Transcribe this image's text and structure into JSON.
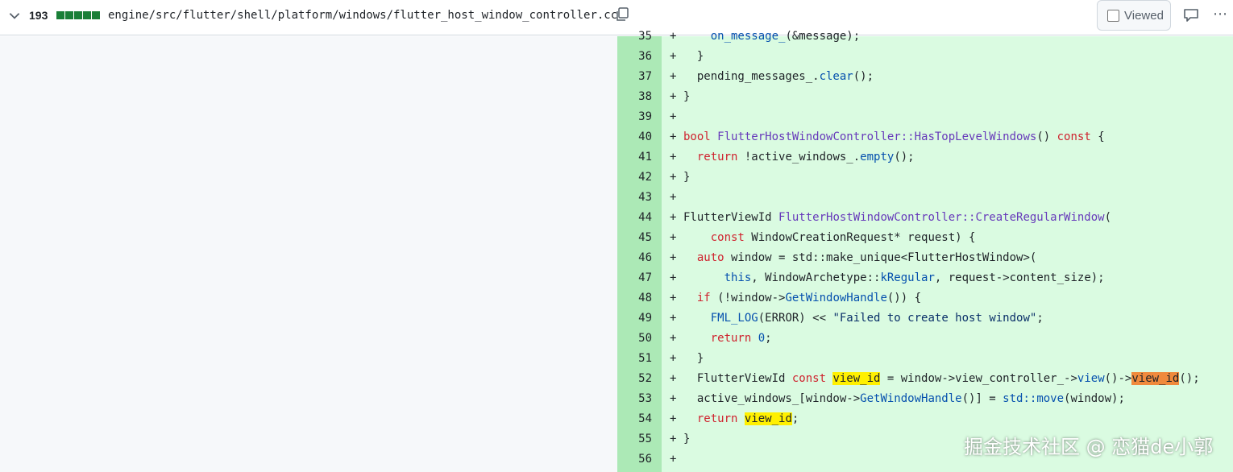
{
  "header": {
    "additions_count": "193",
    "file_path": "engine/src/flutter/shell/platform/windows/flutter_host_window_controller.cc",
    "viewed_label": "Viewed",
    "diffstat_color": "#1a7f37"
  },
  "lines": [
    {
      "num": "35",
      "segs": [
        {
          "t": "    "
        },
        {
          "t": "on_message_",
          "c": "ct"
        },
        {
          "t": "(&message);"
        }
      ]
    },
    {
      "num": "36",
      "segs": [
        {
          "t": "  }"
        }
      ]
    },
    {
      "num": "37",
      "segs": [
        {
          "t": "  pending_messages_."
        },
        {
          "t": "clear",
          "c": "ct"
        },
        {
          "t": "();"
        }
      ]
    },
    {
      "num": "38",
      "segs": [
        {
          "t": "}"
        }
      ]
    },
    {
      "num": "39",
      "segs": []
    },
    {
      "num": "40",
      "segs": [
        {
          "t": "bool",
          "c": "kw"
        },
        {
          "t": " "
        },
        {
          "t": "FlutterHostWindowController::HasTopLevelWindows",
          "c": "fn"
        },
        {
          "t": "() "
        },
        {
          "t": "const",
          "c": "kw"
        },
        {
          "t": " {"
        }
      ]
    },
    {
      "num": "41",
      "segs": [
        {
          "t": "  "
        },
        {
          "t": "return",
          "c": "kw"
        },
        {
          "t": " !active_windows_."
        },
        {
          "t": "empty",
          "c": "ct"
        },
        {
          "t": "();"
        }
      ]
    },
    {
      "num": "42",
      "segs": [
        {
          "t": "}"
        }
      ]
    },
    {
      "num": "43",
      "segs": []
    },
    {
      "num": "44",
      "segs": [
        {
          "t": "FlutterViewId "
        },
        {
          "t": "FlutterHostWindowController::CreateRegularWindow",
          "c": "fn"
        },
        {
          "t": "("
        }
      ]
    },
    {
      "num": "45",
      "segs": [
        {
          "t": "    "
        },
        {
          "t": "const",
          "c": "kw"
        },
        {
          "t": " WindowCreationRequest* request) {"
        }
      ]
    },
    {
      "num": "46",
      "segs": [
        {
          "t": "  "
        },
        {
          "t": "auto",
          "c": "kw"
        },
        {
          "t": " window = std::make_unique<FlutterHostWindow>("
        }
      ]
    },
    {
      "num": "47",
      "segs": [
        {
          "t": "      "
        },
        {
          "t": "this",
          "c": "ct"
        },
        {
          "t": ", WindowArchetype::"
        },
        {
          "t": "kRegular",
          "c": "ct"
        },
        {
          "t": ", request->content_size);"
        }
      ]
    },
    {
      "num": "48",
      "segs": [
        {
          "t": "  "
        },
        {
          "t": "if",
          "c": "kw"
        },
        {
          "t": " (!window->"
        },
        {
          "t": "GetWindowHandle",
          "c": "ct"
        },
        {
          "t": "()) {"
        }
      ]
    },
    {
      "num": "49",
      "segs": [
        {
          "t": "    "
        },
        {
          "t": "FML_LOG",
          "c": "ct"
        },
        {
          "t": "(ERROR) << "
        },
        {
          "t": "\"Failed to create host window\"",
          "c": "st"
        },
        {
          "t": ";"
        }
      ]
    },
    {
      "num": "50",
      "segs": [
        {
          "t": "    "
        },
        {
          "t": "return",
          "c": "kw"
        },
        {
          "t": " "
        },
        {
          "t": "0",
          "c": "ct"
        },
        {
          "t": ";"
        }
      ]
    },
    {
      "num": "51",
      "segs": [
        {
          "t": "  }"
        }
      ]
    },
    {
      "num": "52",
      "segs": [
        {
          "t": "  FlutterViewId "
        },
        {
          "t": "const",
          "c": "kw"
        },
        {
          "t": " "
        },
        {
          "t": "view_id",
          "c": "hl"
        },
        {
          "t": " = window->view_controller_->"
        },
        {
          "t": "view",
          "c": "ct"
        },
        {
          "t": "()->"
        },
        {
          "t": "view_id",
          "c": "hl2"
        },
        {
          "t": "();"
        }
      ]
    },
    {
      "num": "53",
      "segs": [
        {
          "t": "  active_windows_[window->"
        },
        {
          "t": "GetWindowHandle",
          "c": "ct"
        },
        {
          "t": "()] = "
        },
        {
          "t": "std::move",
          "c": "ct"
        },
        {
          "t": "(window);"
        }
      ]
    },
    {
      "num": "54",
      "segs": [
        {
          "t": "  "
        },
        {
          "t": "return",
          "c": "kw"
        },
        {
          "t": " "
        },
        {
          "t": "view_id",
          "c": "hl"
        },
        {
          "t": ";"
        }
      ]
    },
    {
      "num": "55",
      "segs": [
        {
          "t": "}"
        }
      ]
    },
    {
      "num": "56",
      "segs": []
    }
  ],
  "watermark": "掘金技术社区 @ 恋猫de小郭"
}
